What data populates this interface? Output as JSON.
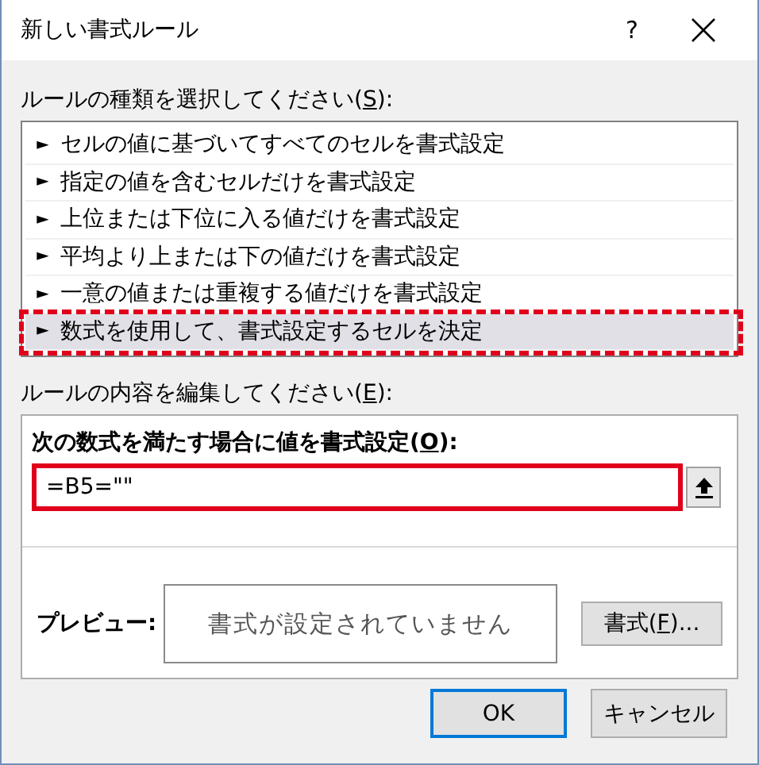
{
  "window": {
    "title": "新しい書式ルール",
    "help": "?"
  },
  "rule_type_label": {
    "before": "ルールの種類を選択してください(",
    "key": "S",
    "after": "):"
  },
  "rule_types": [
    {
      "bullet": "►",
      "label": "セルの値に基づいてすべてのセルを書式設定",
      "selected": false,
      "highlighted": false
    },
    {
      "bullet": "►",
      "label": "指定の値を含むセルだけを書式設定",
      "selected": false,
      "highlighted": false
    },
    {
      "bullet": "►",
      "label": "上位または下位に入る値だけを書式設定",
      "selected": false,
      "highlighted": false
    },
    {
      "bullet": "►",
      "label": "平均より上または下の値だけを書式設定",
      "selected": false,
      "highlighted": false
    },
    {
      "bullet": "►",
      "label": "一意の値または重複する値だけを書式設定",
      "selected": false,
      "highlighted": false
    },
    {
      "bullet": "►",
      "label": "数式を使用して、書式設定するセルを決定",
      "selected": true,
      "highlighted": true
    }
  ],
  "edit_label": {
    "before": "ルールの内容を編集してください(",
    "key": "E",
    "after": "):"
  },
  "formula": {
    "label": {
      "before": "次の数式を満たす場合に値を書式設定(",
      "key": "O",
      "after": "):"
    },
    "value": "=B5=\"\"",
    "highlighted": true
  },
  "preview": {
    "label": "プレビュー:",
    "sample": "書式が設定されていません",
    "format_button": {
      "before": "書式(",
      "key": "F",
      "after": ")..."
    }
  },
  "buttons": [
    {
      "label": "OK",
      "default": true
    },
    {
      "label": "キャンセル",
      "default": false
    }
  ]
}
